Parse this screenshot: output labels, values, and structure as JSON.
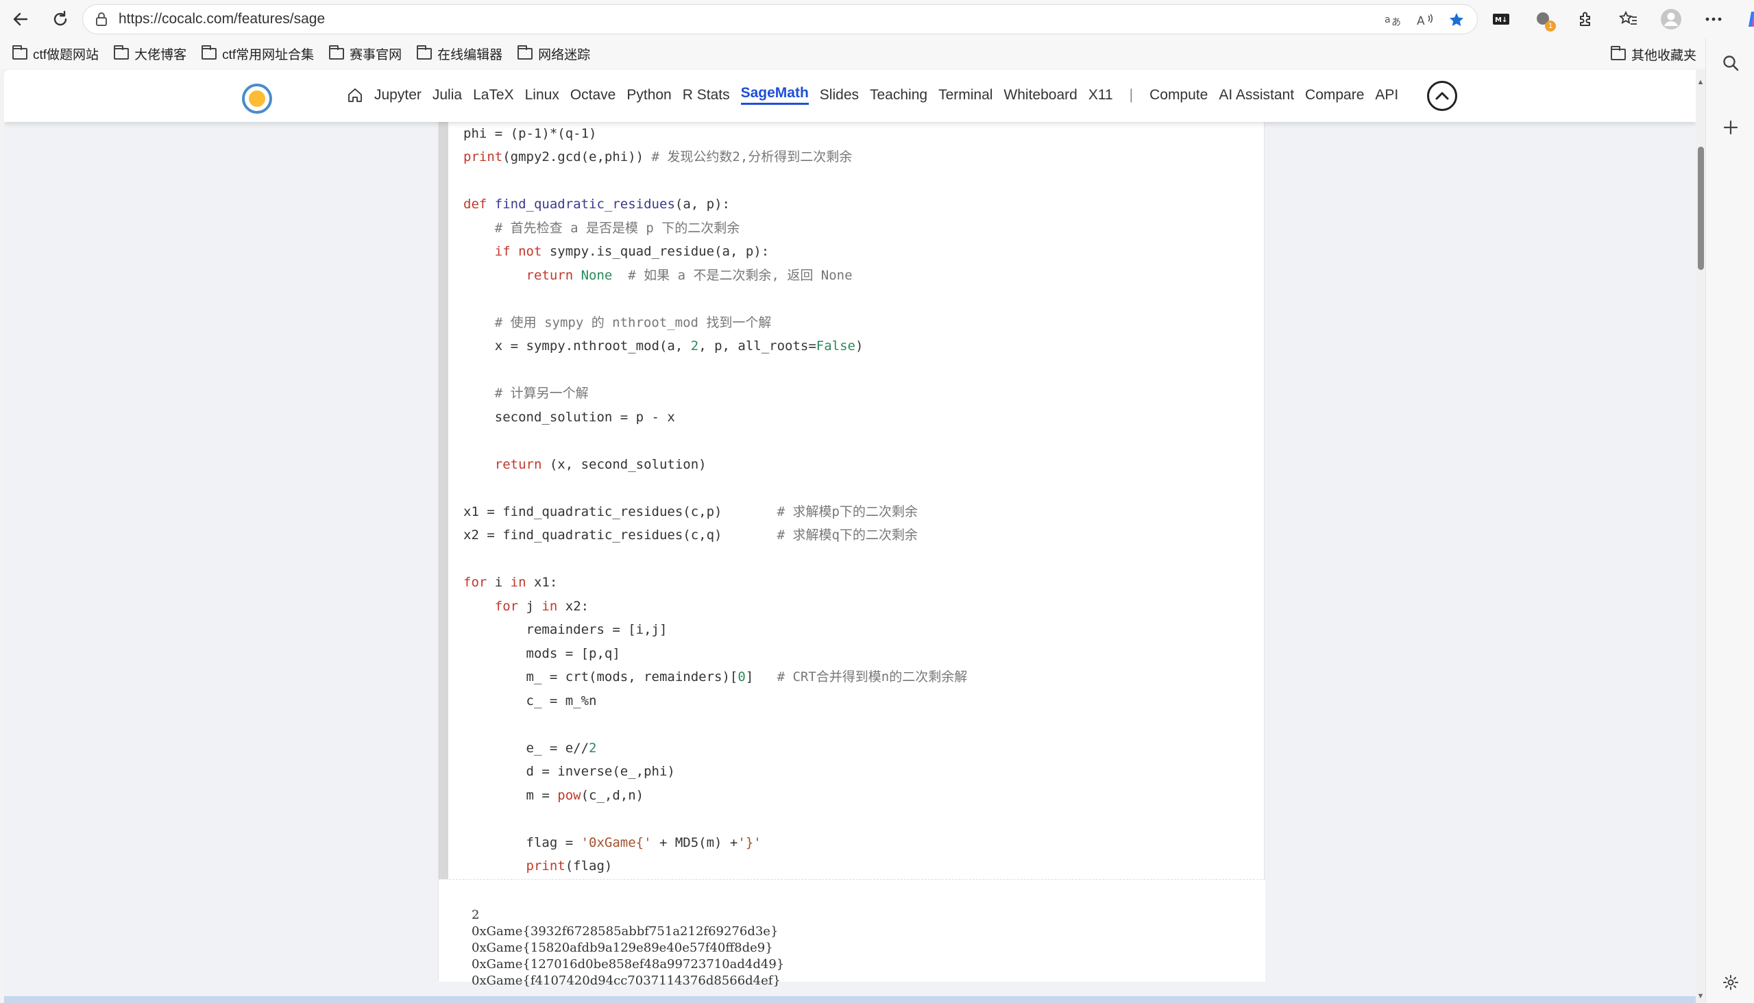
{
  "browser": {
    "url": "https://cocalc.com/features/sage",
    "bookmarks": [
      "ctf做题网站",
      "大佬博客",
      "ctf常用网址合集",
      "赛事官网",
      "在线编辑器",
      "网络迷踪"
    ],
    "other_bookmarks": "其他收藏夹",
    "badge_count": "1"
  },
  "nav": {
    "items": [
      "Jupyter",
      "Julia",
      "LaTeX",
      "Linux",
      "Octave",
      "Python",
      "R Stats",
      "SageMath",
      "Slides",
      "Teaching",
      "Terminal",
      "Whiteboard",
      "X11"
    ],
    "active": "SageMath",
    "separator": "|",
    "items2": [
      "Compute",
      "AI Assistant",
      "Compare",
      "API"
    ]
  },
  "output": {
    "lines": [
      "2",
      "0xGame{3932f6728585abbf751a212f69276d3e}",
      "0xGame{15820afdb9a129e89e40e57f40ff8de9}",
      "0xGame{127016d0be858ef48a99723710ad4d49}",
      "0xGame{f4107420d94cc7037114376d8566d4ef}"
    ]
  }
}
